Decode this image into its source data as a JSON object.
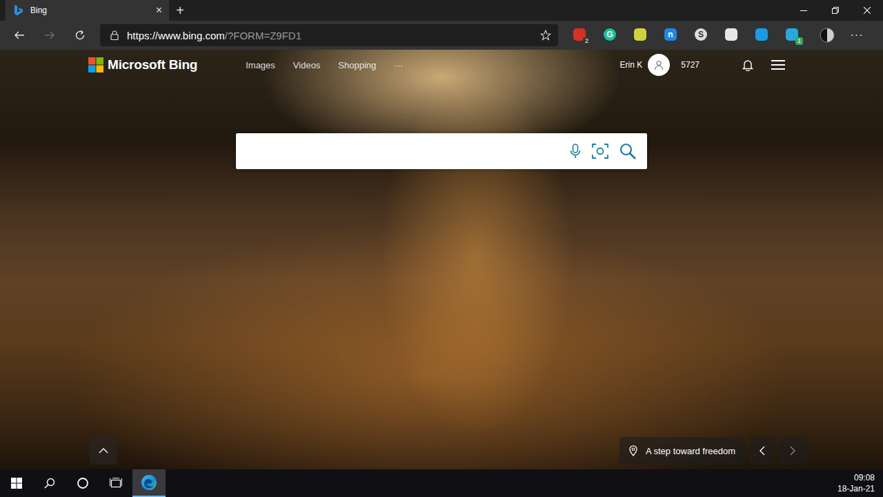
{
  "browser": {
    "tabs": [
      {
        "title": "Bing",
        "selected": true,
        "close": "×"
      }
    ],
    "new_tab": "+",
    "url": {
      "host": "https://www.bing.com",
      "path": "/?FORM=Z9FD1"
    },
    "back_disabled": false,
    "forward_disabled": true,
    "extensions": [
      {
        "color": "#d93025",
        "glyph": "",
        "badge": "2"
      },
      {
        "color": "#15c39a",
        "glyph": "G",
        "badge": ""
      },
      {
        "color": "#cfd23a",
        "glyph": "",
        "badge": ""
      },
      {
        "color": "#1e88e5",
        "glyph": "n",
        "badge": ""
      },
      {
        "color": "#dcdcdc",
        "glyph": "S",
        "badge": ""
      },
      {
        "color": "#e8e8e8",
        "glyph": "",
        "badge": ""
      },
      {
        "color": "#1a9be8",
        "glyph": "",
        "badge": ""
      },
      {
        "color": "#29a8e0",
        "glyph": "",
        "badge": "1"
      }
    ],
    "menu": "···"
  },
  "bing": {
    "logo": "Microsoft Bing",
    "nav": [
      {
        "label": "Images"
      },
      {
        "label": "Videos"
      },
      {
        "label": "Shopping"
      },
      {
        "label": "···"
      }
    ],
    "user": "Erin K",
    "points": "5727",
    "search": {
      "value": ""
    },
    "caption": "A step toward freedom",
    "prev_disabled": false,
    "next_disabled": true
  },
  "taskbar": {
    "edge_active": true,
    "time": "09:08",
    "date": "18-Jan-21"
  }
}
